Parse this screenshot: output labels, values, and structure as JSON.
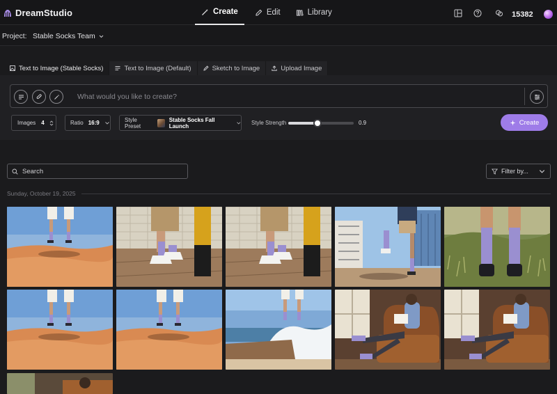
{
  "app": {
    "name": "DreamStudio",
    "credits": "15382"
  },
  "nav": {
    "create": "Create",
    "edit": "Edit",
    "library": "Library"
  },
  "project": {
    "label": "Project:",
    "name": "Stable Socks Team"
  },
  "tabs": [
    {
      "label": "Text to Image (Stable Socks)",
      "active": true
    },
    {
      "label": "Text to Image (Default)",
      "active": false
    },
    {
      "label": "Sketch to Image",
      "active": false
    },
    {
      "label": "Upload Image",
      "active": false
    }
  ],
  "prompt": {
    "placeholder": "What would you like to create?"
  },
  "controls": {
    "images_label": "Images",
    "images_value": "4",
    "ratio_label": "Ratio",
    "ratio_value": "16:9",
    "preset_label": "Style Preset",
    "preset_value": "Stable Socks Fall Launch",
    "strength_label": "Style Strength",
    "strength_value": "0.9",
    "create_label": "Create"
  },
  "gallery": {
    "search_placeholder": "Search",
    "filter_label": "Filter by...",
    "date": "Sunday, October 19, 2025",
    "images": [
      {
        "scene": "desert-jump"
      },
      {
        "scene": "subway-platform"
      },
      {
        "scene": "subway-platform"
      },
      {
        "scene": "city-kick"
      },
      {
        "scene": "grass-closeup"
      },
      {
        "scene": "desert-jump"
      },
      {
        "scene": "desert-jump"
      },
      {
        "scene": "beach-wave"
      },
      {
        "scene": "armchair-reading"
      },
      {
        "scene": "armchair-reading"
      },
      {
        "scene": "armchair-partial"
      }
    ]
  },
  "colors": {
    "accent": "#9e7ce8",
    "background": "#1b1b1d",
    "sock": "#9a8fd0"
  }
}
